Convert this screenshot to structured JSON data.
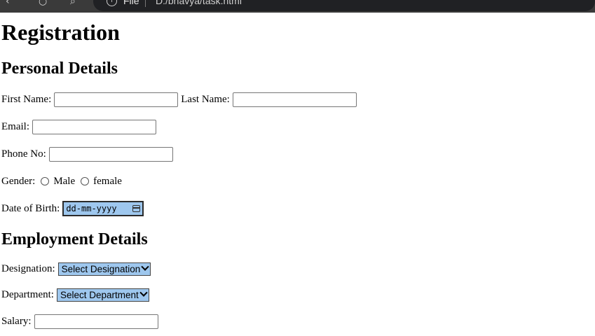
{
  "browser": {
    "file_label": "File",
    "url": "D:/bhavya/task.html"
  },
  "page": {
    "title": "Registration",
    "personal_heading": "Personal Details",
    "employment_heading": "Employment Details"
  },
  "form": {
    "first_name_label": "First Name:",
    "first_name_value": "",
    "last_name_label": "Last Name:",
    "last_name_value": "",
    "email_label": "Email:",
    "email_value": "",
    "phone_label": "Phone No:",
    "phone_value": "",
    "gender_label": "Gender:",
    "gender_options": [
      "Male",
      "female"
    ],
    "dob_label": "Date of Birth:",
    "dob_placeholder": "dd-mm-yyyy",
    "designation_label": "Designation:",
    "designation_selected": "Select Designation",
    "department_label": "Department:",
    "department_selected": "Select Department",
    "salary_label": "Salary:",
    "salary_value": ""
  },
  "colors": {
    "select_bg": "#9ec7ee",
    "chrome_bg": "#3a3a3a"
  }
}
